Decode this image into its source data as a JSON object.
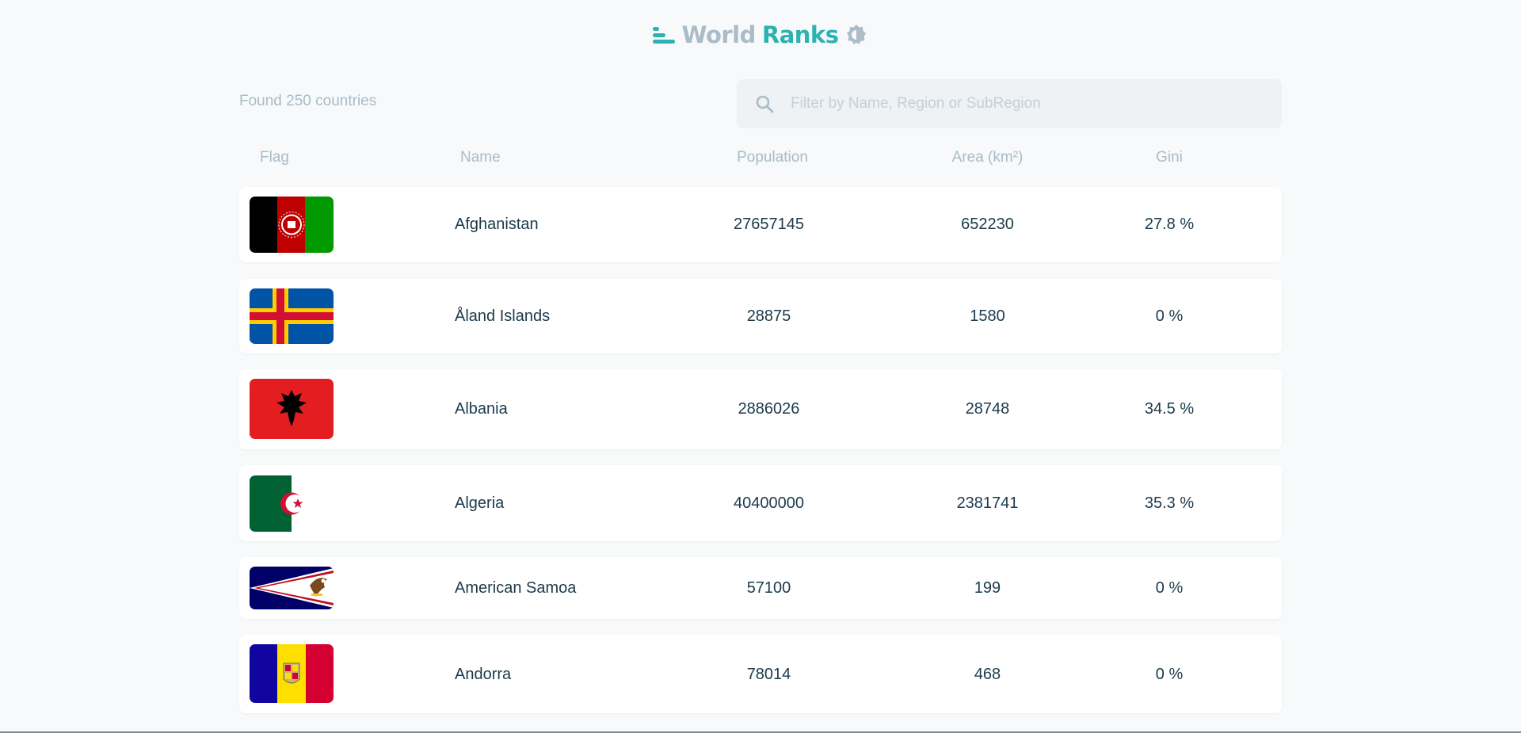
{
  "app": {
    "title_part1": "World",
    "title_part2": "Ranks",
    "accent": "#2bb3b1",
    "icons": [
      "bar-chart-logo-icon",
      "theme-toggle-icon",
      "search-icon"
    ]
  },
  "toolbar": {
    "found_text": "Found 250 countries",
    "search_placeholder": "Filter by Name, Region or SubRegion",
    "search_value": ""
  },
  "table": {
    "headers": {
      "flag": "Flag",
      "name": "Name",
      "population": "Population",
      "area": "Area (km²)",
      "gini": "Gini"
    },
    "rows": [
      {
        "flag": "afghanistan-flag",
        "name": "Afghanistan",
        "population": "27657145",
        "area": "652230",
        "gini": "27.8 %"
      },
      {
        "flag": "aland-islands-flag",
        "name": "Åland Islands",
        "population": "28875",
        "area": "1580",
        "gini": "0 %"
      },
      {
        "flag": "albania-flag",
        "name": "Albania",
        "population": "2886026",
        "area": "28748",
        "gini": "34.5 %"
      },
      {
        "flag": "algeria-flag",
        "name": "Algeria",
        "population": "40400000",
        "area": "2381741",
        "gini": "35.3 %"
      },
      {
        "flag": "american-samoa-flag",
        "name": "American Samoa",
        "population": "57100",
        "area": "199",
        "gini": "0 %"
      },
      {
        "flag": "andorra-flag",
        "name": "Andorra",
        "population": "78014",
        "area": "468",
        "gini": "0 %"
      }
    ]
  }
}
